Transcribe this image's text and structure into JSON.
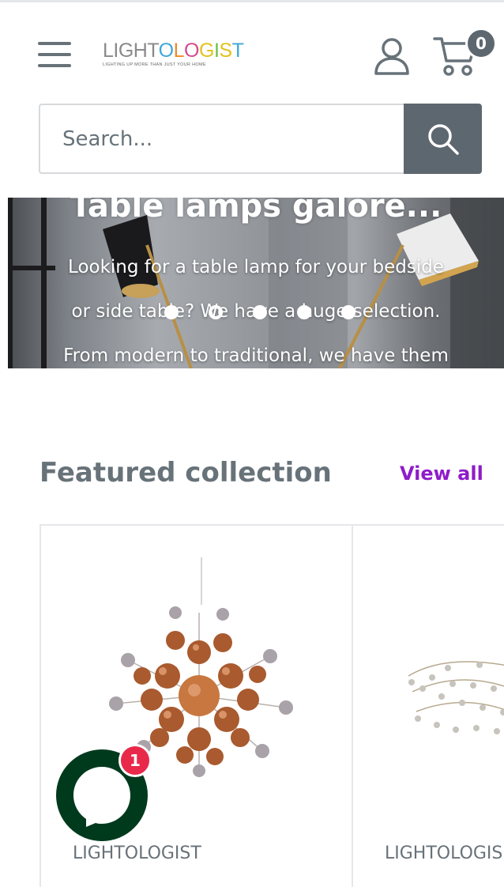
{
  "header": {
    "logo": {
      "word_parts": [
        "LIGHT",
        "O",
        "L",
        "O",
        "G",
        "I",
        "S",
        "T"
      ],
      "tagline": "LIGHTING UP MORE THAN JUST YOUR HOME"
    },
    "cart_count": "0",
    "icons": [
      "hamburger-menu-icon",
      "user-icon",
      "cart-icon"
    ]
  },
  "search": {
    "placeholder": "Search...",
    "value": "",
    "icon": "search-icon"
  },
  "hero": {
    "title": "Table lamps galore...",
    "lines": [
      "Looking for a table lamp for your bedside",
      "or side table? We have a huge selection.",
      "From modern to traditional, we have them"
    ],
    "slide_count": 5,
    "active_slide": 2
  },
  "featured": {
    "title": "Featured collection",
    "view_all_label": "View all",
    "products": [
      {
        "vendor": "LIGHTOLOGIST"
      },
      {
        "vendor": "LIGHTOLOGIS"
      }
    ]
  },
  "chat": {
    "badge_count": "1",
    "icon": "chat-bubble-icon"
  },
  "colors": {
    "text": "#677279",
    "accent": "#8f1cc8",
    "search_button": "#5d6770",
    "chat": "#003a1d",
    "badge": "#e8294a"
  }
}
